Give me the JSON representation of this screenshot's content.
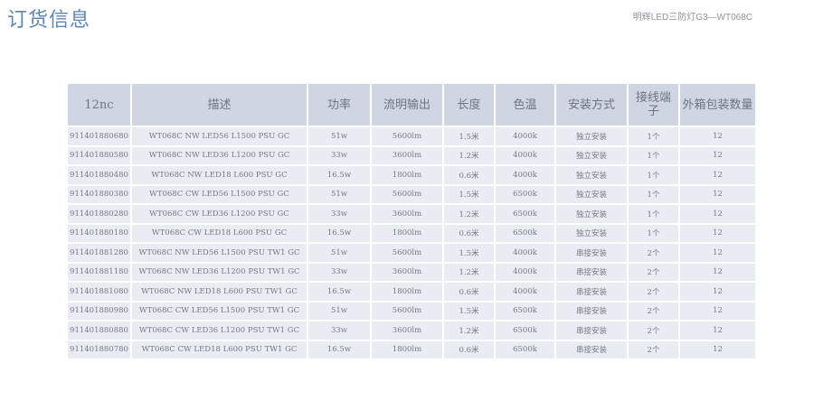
{
  "page": {
    "title": "订货信息",
    "product_label": "明辉LED三防灯G3—WT068C"
  },
  "table": {
    "headers": [
      "12nc",
      "描述",
      "功率",
      "流明输出",
      "长度",
      "色温",
      "安装方式",
      "接线端子",
      "外箱包装数量"
    ],
    "rows": [
      [
        "911401880680",
        "WT068C NW LED56 L1500 PSU GC",
        "51w",
        "5600lm",
        "1.5米",
        "4000k",
        "独立安装",
        "1个",
        "12"
      ],
      [
        "911401880580",
        "WT068C NW LED36 L1200 PSU GC",
        "33w",
        "3600lm",
        "1.2米",
        "4000k",
        "独立安装",
        "1个",
        "12"
      ],
      [
        "911401880480",
        "WT068C NW LED18 L600 PSU GC",
        "16.5w",
        "1800lm",
        "0.6米",
        "4000k",
        "独立安装",
        "1个",
        "12"
      ],
      [
        "911401880380",
        "WT068C CW LED56 L1500 PSU GC",
        "51w",
        "5600lm",
        "1.5米",
        "6500k",
        "独立安装",
        "1个",
        "12"
      ],
      [
        "911401880280",
        "WT068C CW LED36 L1200 PSU GC",
        "33w",
        "3600lm",
        "1.2米",
        "6500k",
        "独立安装",
        "1个",
        "12"
      ],
      [
        "911401880180",
        "WT068C CW LED18 L600 PSU GC",
        "16.5w",
        "1800lm",
        "0.6米",
        "6500k",
        "独立安装",
        "1个",
        "12"
      ],
      [
        "911401881280",
        "WT068C NW LED56 L1500 PSU TW1 GC",
        "51w",
        "5600lm",
        "1.5米",
        "4000k",
        "串接安装",
        "2个",
        "12"
      ],
      [
        "911401881180",
        "WT068C NW LED36 L1200 PSU TW1 GC",
        "33w",
        "3600lm",
        "1.2米",
        "4000k",
        "串接安装",
        "2个",
        "12"
      ],
      [
        "911401881080",
        "WT068C NW LED18 L600 PSU TW1 GC",
        "16.5w",
        "1800lm",
        "0.6米",
        "4000k",
        "串接安装",
        "2个",
        "12"
      ],
      [
        "911401880980",
        "WT068C CW LED56 L1500 PSU TW1 GC",
        "51w",
        "5600lm",
        "1.5米",
        "6500k",
        "串接安装",
        "2个",
        "12"
      ],
      [
        "911401880880",
        "WT068C CW LED36 L1200 PSU TW1 GC",
        "33w",
        "3600lm",
        "1.2米",
        "6500k",
        "串接安装",
        "2个",
        "12"
      ],
      [
        "911401880780",
        "WT068C CW LED18 L600 PSU TW1 GC",
        "16.5w",
        "1800lm",
        "0.6米",
        "6500k",
        "串接安装",
        "2个",
        "12"
      ]
    ]
  }
}
